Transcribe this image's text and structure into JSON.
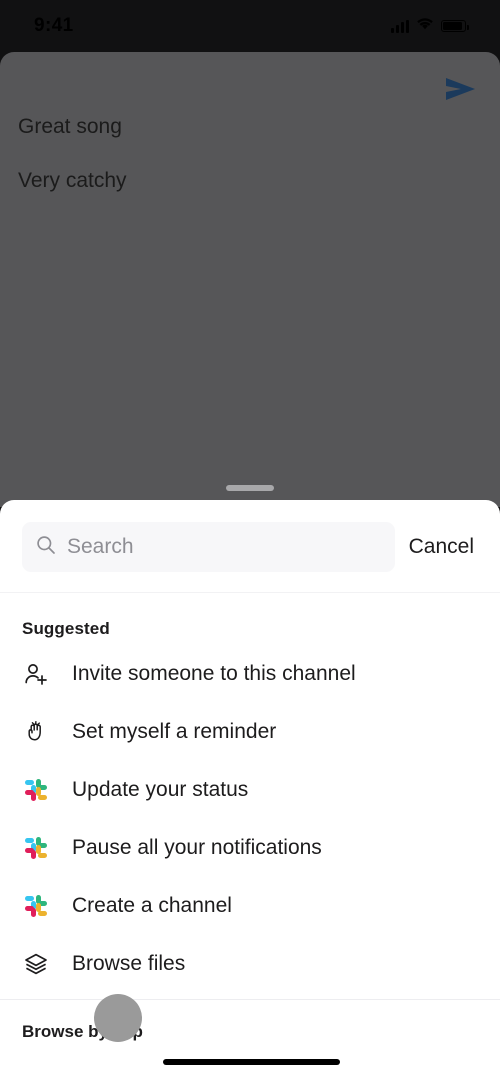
{
  "status_bar": {
    "time": "9:41",
    "signal_icon": "cellular-signal-icon",
    "wifi_icon": "wifi-icon",
    "battery_icon": "battery-icon"
  },
  "conversation": {
    "send_icon": "send-icon",
    "messages": [
      {
        "text": "Great song"
      },
      {
        "text": "Very catchy"
      }
    ]
  },
  "sheet": {
    "drag_handle": "drag-handle",
    "search": {
      "icon": "search-icon",
      "placeholder": "Search",
      "value": ""
    },
    "cancel_label": "Cancel",
    "section_title": "Suggested",
    "items": [
      {
        "label": "Invite someone to this channel",
        "icon": "person-add-icon"
      },
      {
        "label": "Set myself a reminder",
        "icon": "reminder-hand-icon"
      },
      {
        "label": "Update your status",
        "icon": "slack-logo-icon"
      },
      {
        "label": "Pause all your notifications",
        "icon": "slack-logo-icon"
      },
      {
        "label": "Create a channel",
        "icon": "slack-logo-icon"
      },
      {
        "label": "Browse files",
        "icon": "layers-icon"
      }
    ],
    "footer_label": "Browse by app"
  },
  "overlay": {
    "touch_indicator": "touch-indicator",
    "home_indicator": "home-indicator"
  },
  "colors": {
    "backdrop": "#565658",
    "sheet_bg": "#ffffff",
    "text": "#1d1c1d",
    "placeholder": "#8e8e94",
    "send_blue": "#1b3a5c",
    "slack_cyan": "#36c5f0",
    "slack_green": "#2eb67d",
    "slack_yellow": "#ecb22e",
    "slack_magenta": "#e01e5a"
  }
}
